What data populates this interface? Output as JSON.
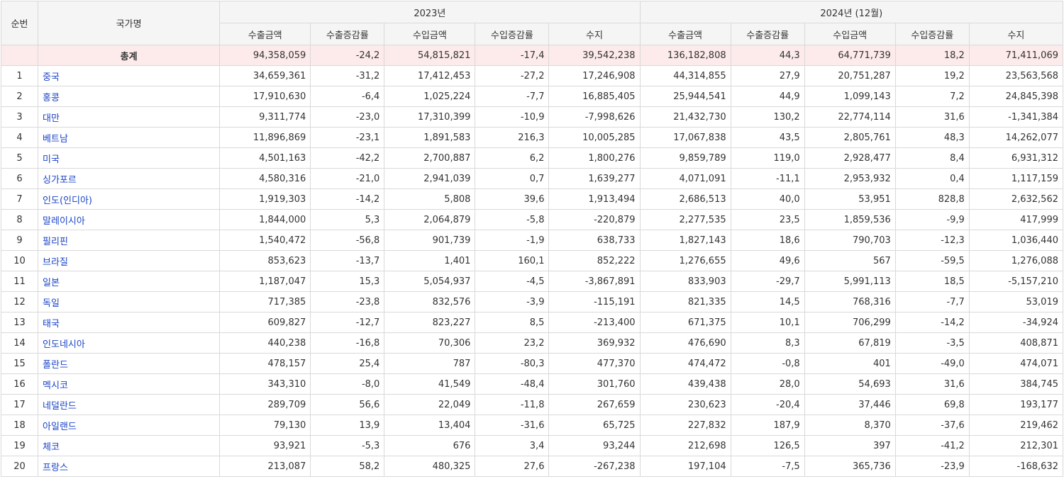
{
  "headers": {
    "rank": "순번",
    "country": "국가명",
    "year1": "2023년",
    "year2": "2024년 (12월)",
    "cols": [
      "수출금액",
      "수출증감률",
      "수입금액",
      "수입증감률",
      "수지"
    ]
  },
  "total": {
    "name": "총계",
    "v": [
      "94,358,059",
      "-24,2",
      "54,815,821",
      "-17,4",
      "39,542,238",
      "136,182,808",
      "44,3",
      "64,771,739",
      "18,2",
      "71,411,069"
    ]
  },
  "rows": [
    {
      "rank": "1",
      "name": "중국",
      "v": [
        "34,659,361",
        "-31,2",
        "17,412,453",
        "-27,2",
        "17,246,908",
        "44,314,855",
        "27,9",
        "20,751,287",
        "19,2",
        "23,563,568"
      ]
    },
    {
      "rank": "2",
      "name": "홍콩",
      "v": [
        "17,910,630",
        "-6,4",
        "1,025,224",
        "-7,7",
        "16,885,405",
        "25,944,541",
        "44,9",
        "1,099,143",
        "7,2",
        "24,845,398"
      ]
    },
    {
      "rank": "3",
      "name": "대만",
      "v": [
        "9,311,774",
        "-23,0",
        "17,310,399",
        "-10,9",
        "-7,998,626",
        "21,432,730",
        "130,2",
        "22,774,114",
        "31,6",
        "-1,341,384"
      ]
    },
    {
      "rank": "4",
      "name": "베트남",
      "v": [
        "11,896,869",
        "-23,1",
        "1,891,583",
        "216,3",
        "10,005,285",
        "17,067,838",
        "43,5",
        "2,805,761",
        "48,3",
        "14,262,077"
      ]
    },
    {
      "rank": "5",
      "name": "미국",
      "v": [
        "4,501,163",
        "-42,2",
        "2,700,887",
        "6,2",
        "1,800,276",
        "9,859,789",
        "119,0",
        "2,928,477",
        "8,4",
        "6,931,312"
      ]
    },
    {
      "rank": "6",
      "name": "싱가포르",
      "v": [
        "4,580,316",
        "-21,0",
        "2,941,039",
        "0,7",
        "1,639,277",
        "4,071,091",
        "-11,1",
        "2,953,932",
        "0,4",
        "1,117,159"
      ]
    },
    {
      "rank": "7",
      "name": "인도(인디아)",
      "v": [
        "1,919,303",
        "-14,2",
        "5,808",
        "39,6",
        "1,913,494",
        "2,686,513",
        "40,0",
        "53,951",
        "828,8",
        "2,632,562"
      ]
    },
    {
      "rank": "8",
      "name": "말레이시아",
      "v": [
        "1,844,000",
        "5,3",
        "2,064,879",
        "-5,8",
        "-220,879",
        "2,277,535",
        "23,5",
        "1,859,536",
        "-9,9",
        "417,999"
      ]
    },
    {
      "rank": "9",
      "name": "필리핀",
      "v": [
        "1,540,472",
        "-56,8",
        "901,739",
        "-1,9",
        "638,733",
        "1,827,143",
        "18,6",
        "790,703",
        "-12,3",
        "1,036,440"
      ]
    },
    {
      "rank": "10",
      "name": "브라질",
      "v": [
        "853,623",
        "-13,7",
        "1,401",
        "160,1",
        "852,222",
        "1,276,655",
        "49,6",
        "567",
        "-59,5",
        "1,276,088"
      ]
    },
    {
      "rank": "11",
      "name": "일본",
      "v": [
        "1,187,047",
        "15,3",
        "5,054,937",
        "-4,5",
        "-3,867,891",
        "833,903",
        "-29,7",
        "5,991,113",
        "18,5",
        "-5,157,210"
      ]
    },
    {
      "rank": "12",
      "name": "독일",
      "v": [
        "717,385",
        "-23,8",
        "832,576",
        "-3,9",
        "-115,191",
        "821,335",
        "14,5",
        "768,316",
        "-7,7",
        "53,019"
      ]
    },
    {
      "rank": "13",
      "name": "태국",
      "v": [
        "609,827",
        "-12,7",
        "823,227",
        "8,5",
        "-213,400",
        "671,375",
        "10,1",
        "706,299",
        "-14,2",
        "-34,924"
      ]
    },
    {
      "rank": "14",
      "name": "인도네시아",
      "v": [
        "440,238",
        "-16,8",
        "70,306",
        "23,2",
        "369,932",
        "476,690",
        "8,3",
        "67,819",
        "-3,5",
        "408,871"
      ]
    },
    {
      "rank": "15",
      "name": "폴란드",
      "v": [
        "478,157",
        "25,4",
        "787",
        "-80,3",
        "477,370",
        "474,472",
        "-0,8",
        "401",
        "-49,0",
        "474,071"
      ]
    },
    {
      "rank": "16",
      "name": "멕시코",
      "v": [
        "343,310",
        "-8,0",
        "41,549",
        "-48,4",
        "301,760",
        "439,438",
        "28,0",
        "54,693",
        "31,6",
        "384,745"
      ]
    },
    {
      "rank": "17",
      "name": "네덜란드",
      "v": [
        "289,709",
        "56,6",
        "22,049",
        "-11,8",
        "267,659",
        "230,623",
        "-20,4",
        "37,446",
        "69,8",
        "193,177"
      ]
    },
    {
      "rank": "18",
      "name": "아일랜드",
      "v": [
        "79,130",
        "13,9",
        "13,404",
        "-31,6",
        "65,725",
        "227,832",
        "187,9",
        "8,370",
        "-37,6",
        "219,462"
      ]
    },
    {
      "rank": "19",
      "name": "체코",
      "v": [
        "93,921",
        "-5,3",
        "676",
        "3,4",
        "93,244",
        "212,698",
        "126,5",
        "397",
        "-41,2",
        "212,301"
      ]
    },
    {
      "rank": "20",
      "name": "프랑스",
      "v": [
        "213,087",
        "58,2",
        "480,325",
        "27,6",
        "-267,238",
        "197,104",
        "-7,5",
        "365,736",
        "-23,9",
        "-168,632"
      ]
    }
  ]
}
